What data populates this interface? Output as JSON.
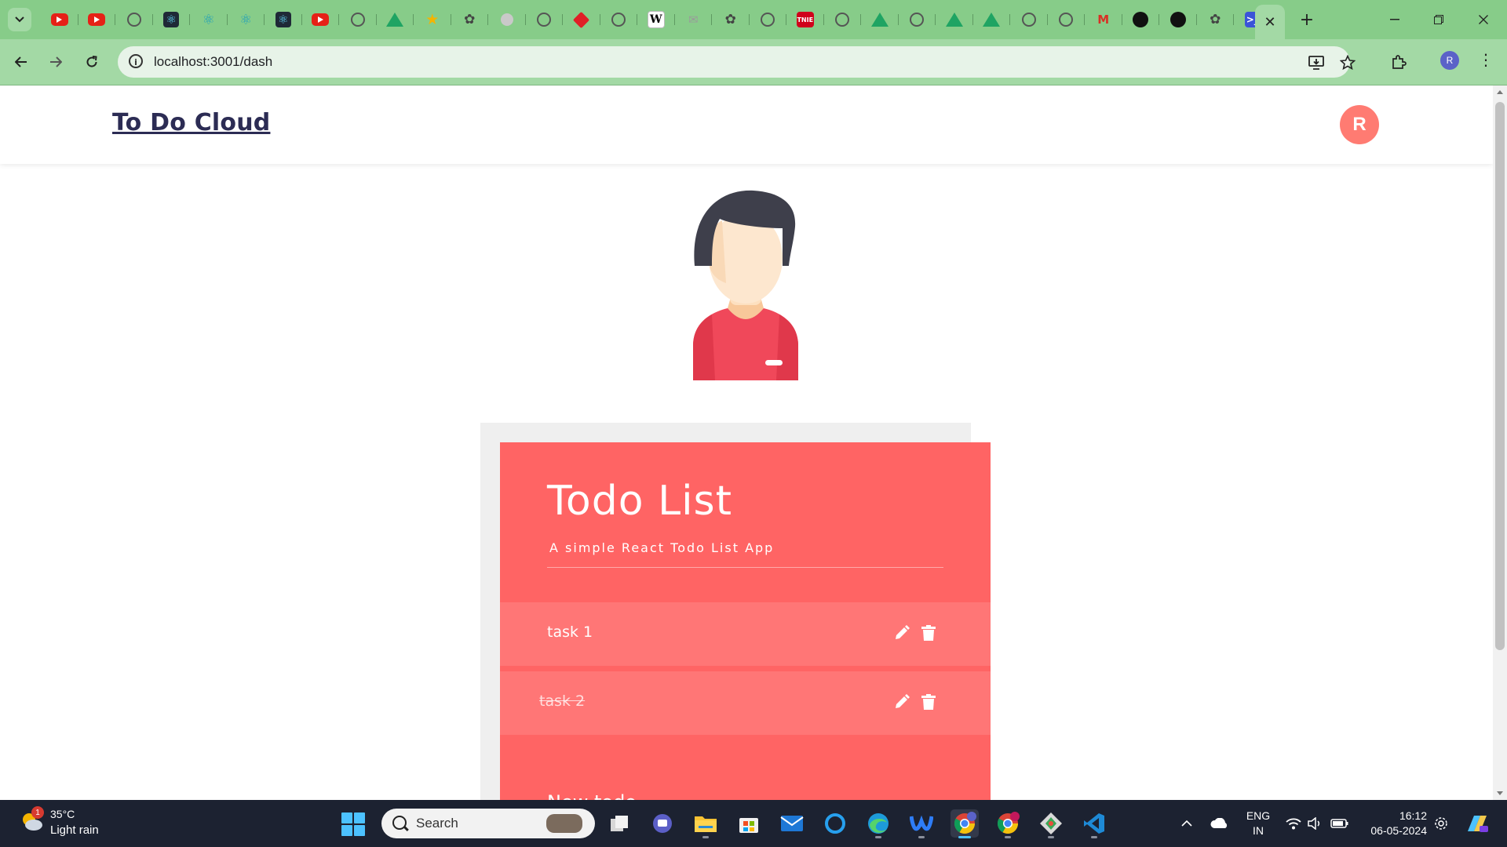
{
  "browser": {
    "tab_favicons": [
      "youtube-icon",
      "youtube-icon",
      "globe-icon",
      "react-icon",
      "react-icon",
      "react-icon",
      "react-icon",
      "youtube-icon",
      "globe-icon",
      "google-drive-icon",
      "star-icon",
      "chatgpt-icon",
      "globe-icon",
      "globe-icon",
      "red-diamond-icon",
      "globe-icon",
      "wikipedia-icon",
      "gmail-icon",
      "chatgpt-icon",
      "globe-icon",
      "tnie-icon",
      "globe-icon",
      "google-drive-icon",
      "globe-icon",
      "google-drive-icon",
      "google-drive-icon",
      "globe-icon",
      "globe-icon",
      "gmail-icon",
      "github-icon",
      "github-icon",
      "chatgpt-icon",
      "powershell-icon"
    ],
    "wiki_letter": "W",
    "tnie_label": "TNIE",
    "active_tab_close": "✕",
    "new_tab": "+",
    "url": "localhost:3001/dash",
    "profile_initial": "R",
    "colors": {
      "tabstrip": "#87cc89",
      "toolbar": "#a3d9a5"
    }
  },
  "app": {
    "brand": "To Do Cloud",
    "user_initial": "R",
    "colors": {
      "accent": "#ff6464",
      "item": "#ff7676",
      "avatar": "#ff7b72",
      "brand": "#2c2c54"
    }
  },
  "todo": {
    "title": "Todo List",
    "subtitle": "A simple React Todo List App",
    "items": [
      {
        "label": "task 1",
        "completed": false
      },
      {
        "label": "task 2",
        "completed": true
      }
    ],
    "new_todo_label": "New todo"
  },
  "taskbar": {
    "weather": {
      "badge": "1",
      "temp": "35°C",
      "desc": "Light rain"
    },
    "search_placeholder": "Search",
    "apps": [
      "task-view-icon",
      "teams-icon",
      "file-explorer-icon",
      "store-icon",
      "mail-icon",
      "cortana-icon",
      "edge-icon",
      "webex-icon",
      "chrome-icon",
      "chrome-profile-icon",
      "git-icon",
      "vscode-icon"
    ],
    "lang": {
      "line1": "ENG",
      "line2": "IN"
    },
    "clock": {
      "time": "16:12",
      "date": "06-05-2024"
    }
  }
}
